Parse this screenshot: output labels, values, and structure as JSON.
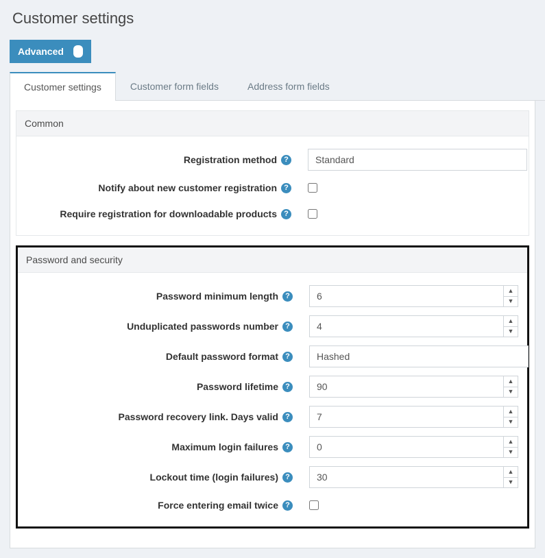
{
  "pageTitle": "Customer settings",
  "advancedLabel": "Advanced",
  "tabs": [
    {
      "label": "Customer settings"
    },
    {
      "label": "Customer form fields"
    },
    {
      "label": "Address form fields"
    }
  ],
  "sections": {
    "common": {
      "title": "Common",
      "registrationMethod": {
        "label": "Registration method",
        "value": "Standard"
      },
      "notifyNew": {
        "label": "Notify about new customer registration",
        "checked": false
      },
      "requireRegDownload": {
        "label": "Require registration for downloadable products",
        "checked": false
      }
    },
    "password": {
      "title": "Password and security",
      "minLength": {
        "label": "Password minimum length",
        "value": "6"
      },
      "undup": {
        "label": "Unduplicated passwords number",
        "value": "4"
      },
      "defaultFormat": {
        "label": "Default password format",
        "value": "Hashed"
      },
      "lifetime": {
        "label": "Password lifetime",
        "value": "90"
      },
      "recoveryDays": {
        "label": "Password recovery link. Days valid",
        "value": "7"
      },
      "maxFail": {
        "label": "Maximum login failures",
        "value": "0"
      },
      "lockoutTime": {
        "label": "Lockout time (login failures)",
        "value": "30"
      },
      "forceEmailTwice": {
        "label": "Force entering email twice",
        "checked": false
      }
    }
  }
}
